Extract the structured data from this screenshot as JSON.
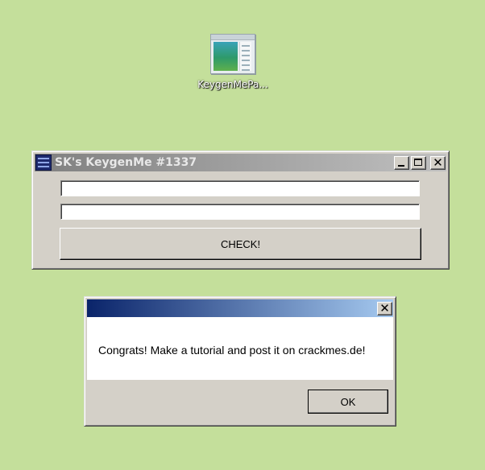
{
  "desktop": {
    "icon": {
      "name": "KeygenMePa...",
      "icon": "document-preview-icon"
    }
  },
  "keygen_window": {
    "title": "SK's KeygenMe #1337",
    "app_icon": "app-icon",
    "controls": {
      "minimize": "minimize-icon",
      "maximize": "maximize-icon",
      "close": "✕"
    },
    "name_field": {
      "value": "",
      "placeholder": ""
    },
    "serial_field": {
      "value": "",
      "placeholder": ""
    },
    "check_label": "CHECK!"
  },
  "message_box": {
    "title": "",
    "close": "✕",
    "text": "Congrats! Make a tutorial and post it on crackmes.de!",
    "ok_label": "OK"
  },
  "colors": {
    "desktop": "#c4df9b",
    "inactive_title_start": "#808080",
    "active_title_start": "#0a246a",
    "active_title_end": "#a6caf0",
    "window_face": "#d4d0c8"
  }
}
